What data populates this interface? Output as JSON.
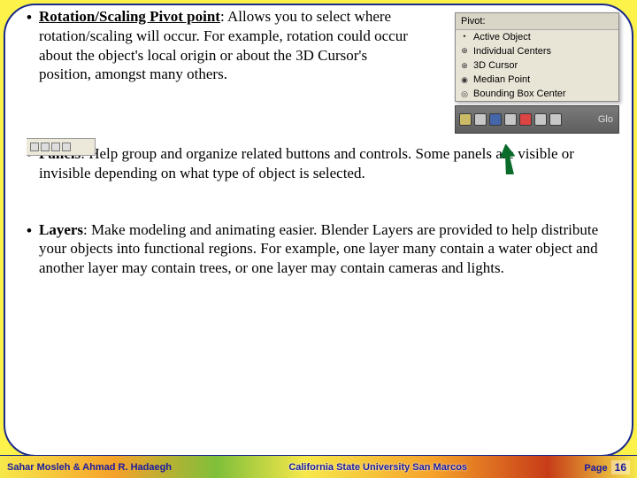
{
  "bullets": [
    {
      "term": "Rotation/Scaling Pivot point",
      "text": ": Allows you to select where rotation/scaling will occur. For example, rotation could occur about the object's local origin or about the 3D Cursor's position, amongst many others."
    },
    {
      "term": "Panels",
      "text": ": Help group and organize related buttons and controls. Some panels are visible or invisible depending on what type of object is selected."
    },
    {
      "term": "Layers",
      "text": ": Make modeling and animating easier. Blender Layers are provided to help distribute your objects into functional regions. For example, one layer many contain a water object and another layer may contain trees, or one layer may contain cameras and lights."
    }
  ],
  "pivot_menu": {
    "header": "Pivot:",
    "items": [
      {
        "icon": "•",
        "label": "Active Object"
      },
      {
        "icon": "⊕",
        "label": "Individual Centers"
      },
      {
        "icon": "⊕",
        "label": "3D Cursor"
      },
      {
        "icon": "◉",
        "label": "Median Point"
      },
      {
        "icon": "◎",
        "label": "Bounding Box Center"
      }
    ],
    "toolbar_text": "Glo"
  },
  "footer": {
    "authors": "Sahar Mosleh & Ahmad R. Hadaegh",
    "university": "California State University San Marcos",
    "page_label": "Page",
    "page_number": "16"
  }
}
